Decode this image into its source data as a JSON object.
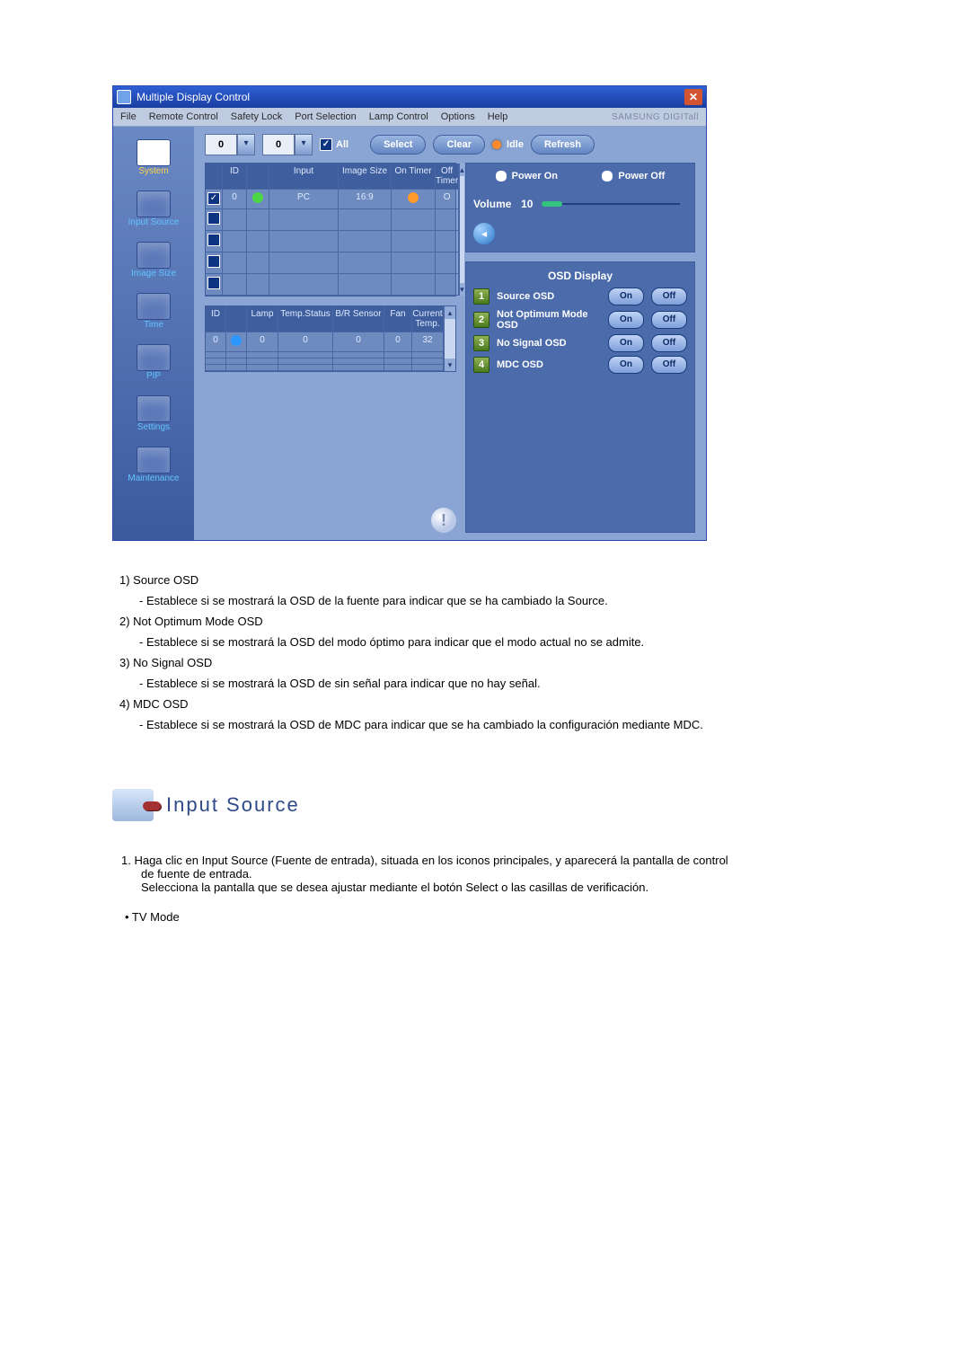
{
  "app": {
    "title": "Multiple Display Control",
    "closeGlyph": "✕",
    "brand": "SAMSUNG DIGITall"
  },
  "menu": {
    "file": "File",
    "remote": "Remote Control",
    "safety": "Safety Lock",
    "port": "Port Selection",
    "lamp": "Lamp Control",
    "options": "Options",
    "help": "Help"
  },
  "sidebar": {
    "system": "System",
    "inputSource": "Input Source",
    "imageSize": "Image Size",
    "time": "Time",
    "pip": "PIP",
    "settings": "Settings",
    "maintenance": "Maintenance"
  },
  "toolbar": {
    "sp1": "0",
    "sp2": "0",
    "all": "All",
    "select": "Select",
    "clear": "Clear",
    "idle": "Idle",
    "refresh": "Refresh"
  },
  "table1": {
    "cols": [
      "",
      "ID",
      "",
      "Input",
      "Image Size",
      "On Timer",
      "Off Timer"
    ],
    "w": [
      "18px",
      "26px",
      "24px",
      "76px",
      "58px",
      "48px",
      "1"
    ],
    "rows": [
      {
        "chk": "✓",
        "id": "0",
        "dot": "green",
        "input": "PC",
        "size": "16:9",
        "on": "orange",
        "off": "O"
      },
      {
        "chk": "",
        "id": "",
        "dot": "",
        "input": "",
        "size": "",
        "on": "",
        "off": ""
      },
      {
        "chk": "",
        "id": "",
        "dot": "",
        "input": "",
        "size": "",
        "on": "",
        "off": ""
      },
      {
        "chk": "",
        "id": "",
        "dot": "",
        "input": "",
        "size": "",
        "on": "",
        "off": ""
      },
      {
        "chk": "",
        "id": "",
        "dot": "",
        "input": "",
        "size": "",
        "on": "",
        "off": ""
      }
    ]
  },
  "table2": {
    "cols": [
      "ID",
      "",
      "Lamp",
      "Temp.Status",
      "B/R Sensor",
      "Fan",
      "Current Temp."
    ],
    "w": [
      "22px",
      "22px",
      "34px",
      "60px",
      "56px",
      "30px",
      "1"
    ],
    "rows": [
      {
        "id": "0",
        "dot": "blue",
        "lamp": "0",
        "temp": "0",
        "sensor": "0",
        "fan": "0",
        "cur": "32"
      },
      {
        "id": "",
        "dot": "",
        "lamp": "",
        "temp": "",
        "sensor": "",
        "fan": "",
        "cur": ""
      },
      {
        "id": "",
        "dot": "",
        "lamp": "",
        "temp": "",
        "sensor": "",
        "fan": "",
        "cur": ""
      },
      {
        "id": "",
        "dot": "",
        "lamp": "",
        "temp": "",
        "sensor": "",
        "fan": "",
        "cur": ""
      }
    ]
  },
  "power": {
    "on": "Power On",
    "off": "Power Off"
  },
  "volume": {
    "label": "Volume",
    "value": "10",
    "speakerGlyph": "◂"
  },
  "osd": {
    "title": "OSD Display",
    "on": "On",
    "off": "Off",
    "items": [
      {
        "n": "1",
        "label": "Source OSD"
      },
      {
        "n": "2",
        "label": "Not Optimum Mode OSD"
      },
      {
        "n": "3",
        "label": "No Signal OSD"
      },
      {
        "n": "4",
        "label": "MDC OSD"
      }
    ]
  },
  "info": "!",
  "explain": {
    "l1": "1)  Source OSD",
    "l1s": "- Establece si se mostrará la OSD de la fuente para indicar que se ha cambiado la Source.",
    "l2": "2)  Not Optimum Mode OSD",
    "l2s": "- Establece si se mostrará la OSD del modo óptimo para indicar que el modo actual no se admite.",
    "l3": "3)  No Signal OSD",
    "l3s": "- Establece si se mostrará la OSD de sin señal para indicar que no hay señal.",
    "l4": "4)  MDC OSD",
    "l4s": "- Establece si se mostrará la OSD de MDC para indicar que se ha cambiado la configuración mediante MDC."
  },
  "section": {
    "title": "Input Source",
    "p1a": "1.  Haga clic en Input Source (Fuente de entrada), situada en los iconos principales, y aparecerá la pantalla de control",
    "p1b": "de fuente de entrada.",
    "p1c": "Selecciona la pantalla que se desea ajustar mediante el botón Select o las casillas de verificación.",
    "bullet": "•  TV Mode"
  }
}
